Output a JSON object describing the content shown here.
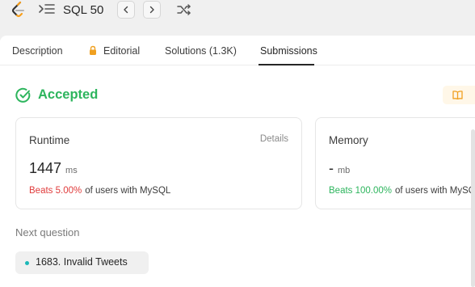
{
  "header": {
    "title": "SQL 50",
    "icons": [
      "leetcode-logo",
      "list-icon",
      "chevron-left-icon",
      "chevron-right-icon",
      "shuffle-icon"
    ]
  },
  "tabs": [
    {
      "label": "Description"
    },
    {
      "label": "Editorial",
      "icon": "lock-icon"
    },
    {
      "label": "Solutions (1.3K)"
    },
    {
      "label": "Submissions",
      "active": true
    }
  ],
  "status": {
    "label": "Accepted",
    "color": "#2db55d"
  },
  "runtime": {
    "label": "Runtime",
    "details": "Details",
    "value": "1447",
    "unit": "ms",
    "beats": "Beats 5.00%",
    "beats_suffix": "of users with MySQL"
  },
  "memory": {
    "label": "Memory",
    "value": "-",
    "unit": "mb",
    "beats": "Beats 100.00%",
    "beats_suffix": "of users with MySQL"
  },
  "next_question": {
    "label": "Next question",
    "title": "1683. Invalid Tweets"
  },
  "colors": {
    "accent_green": "#2db55d",
    "beats_red": "#e03c3c",
    "easy_teal": "#1cb8b8"
  }
}
